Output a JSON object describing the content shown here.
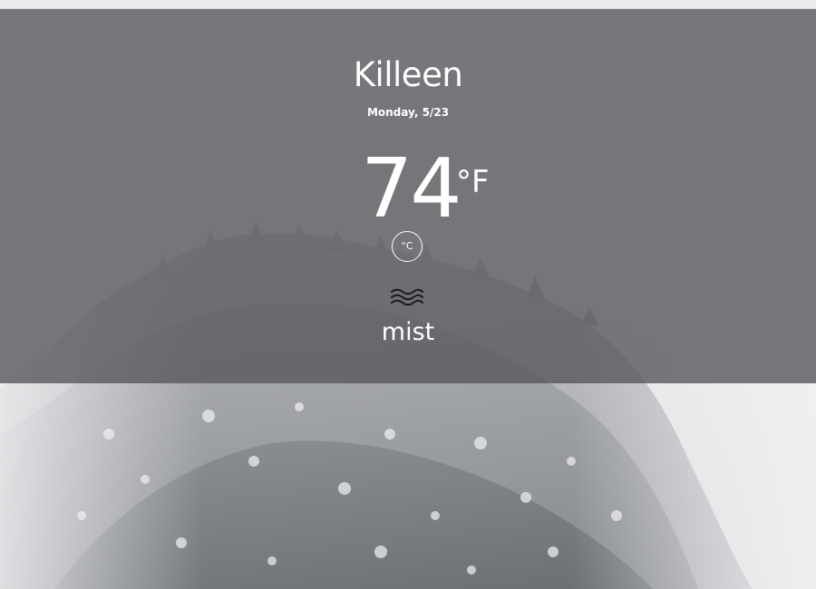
{
  "weather": {
    "city": "Killeen",
    "date": "Monday, 5/23",
    "temperature": "74",
    "unit": "°F",
    "toggle_unit": "°C",
    "condition": "mist",
    "condition_icon": "mist-icon"
  },
  "colors": {
    "overlay": "#5f5f63",
    "text": "#ffffff",
    "icon": "#1a1a1a"
  }
}
